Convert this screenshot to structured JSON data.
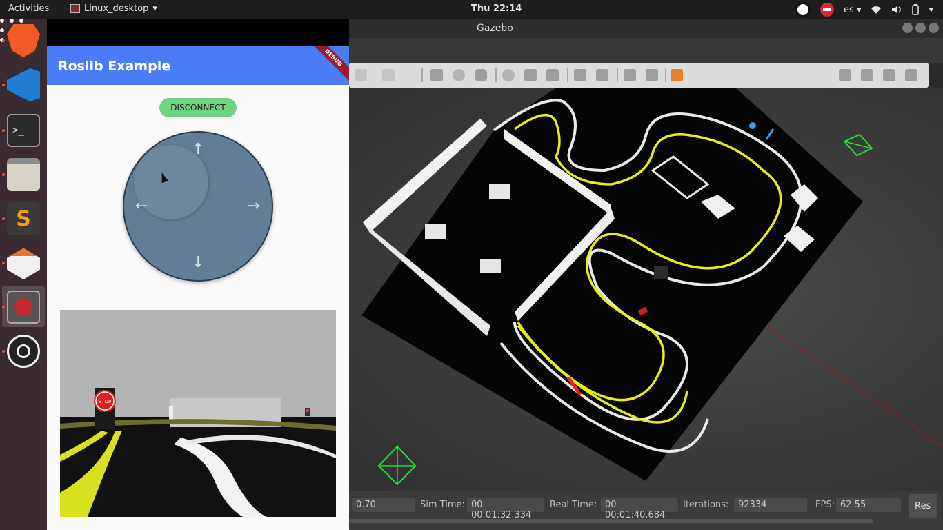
{
  "topbar": {
    "activities": "Activities",
    "app_menu": "Linux_desktop",
    "app_menu_arrow": "▾",
    "clock": "Thu 22:14",
    "keyboard_layout": "es",
    "layout_arrow": "▾",
    "wifi_icon": "wifi-icon",
    "volume_icon": "volume-icon",
    "battery_icon": "battery-icon",
    "system_arrow": "▾"
  },
  "dock": {
    "items": [
      "brave-browser",
      "visual-studio-code",
      "terminal",
      "files",
      "sublime-text",
      "stacer",
      "screen-recorder",
      "obs-studio"
    ],
    "terminal_prompt": ">_",
    "sublime_glyph": "S",
    "show_apps": "show-applications"
  },
  "flutter_app": {
    "title": "Roslib Example",
    "debug_banner": "DEBUG",
    "disconnect_label": "DISCONNECT",
    "joystick_arrows": {
      "up": "↑",
      "down": "↓",
      "left": "←",
      "right": "→"
    },
    "stop_sign_text": "STOP",
    "colors": {
      "appbar": "#4a7cf5",
      "button": "#6ed47f",
      "joystick": "#627e96"
    }
  },
  "gazebo": {
    "window_title": "Gazebo",
    "status": {
      "real_time_factor": "0.70",
      "sim_time_label": "Sim Time:",
      "sim_time": "00 00:01:32.334",
      "real_time_label": "Real Time:",
      "real_time": "00 00:01:40.684",
      "iterations_label": "Iterations:",
      "iterations": "92334",
      "fps_label": "FPS:",
      "fps": "62.55",
      "reset_label": "Res"
    }
  }
}
